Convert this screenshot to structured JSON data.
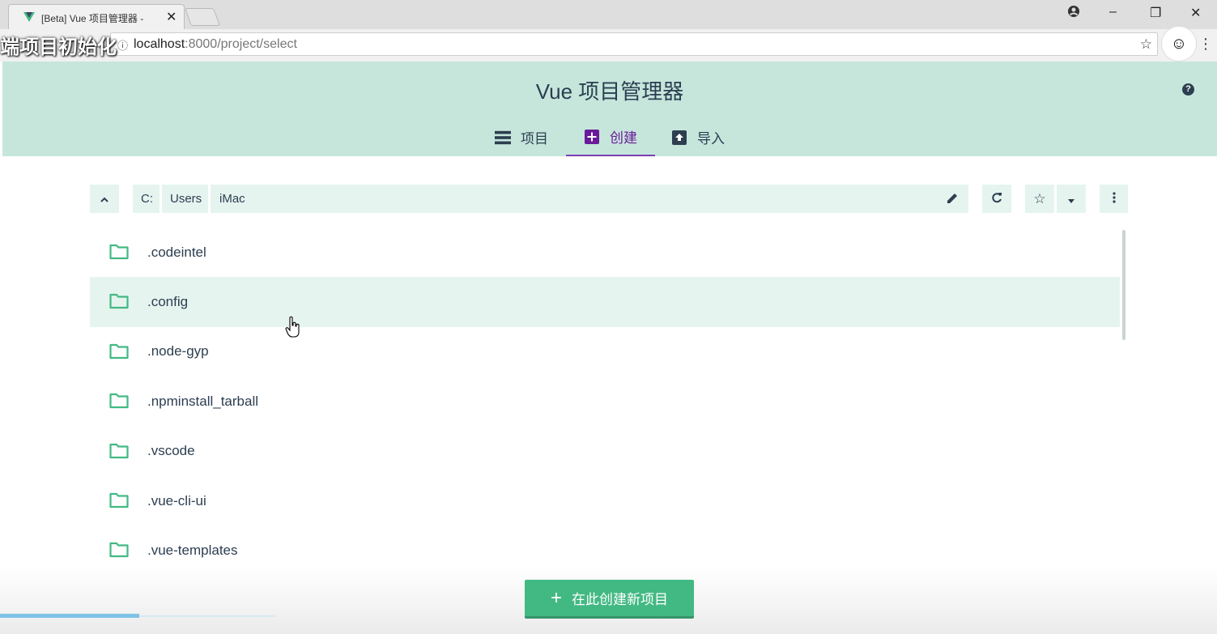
{
  "browser": {
    "tab_title": "[Beta] Vue 项目管理器 -",
    "tab_close": "✕",
    "url_host": "localhost",
    "url_rest": ":8000/project/select",
    "overlay_caption": "端项目初始化",
    "win_minimize": "–",
    "win_restore": "❐",
    "win_close": "✕"
  },
  "app": {
    "title": "Vue 项目管理器",
    "help": "?",
    "tabs": [
      {
        "label": "项目",
        "icon": "list-icon",
        "active": false
      },
      {
        "label": "创建",
        "icon": "add-box-icon",
        "active": true
      },
      {
        "label": "导入",
        "icon": "unarchive-icon",
        "active": false
      }
    ]
  },
  "pathbar": {
    "crumbs": [
      "C:",
      "Users",
      "iMac"
    ]
  },
  "folders": [
    ".codeintel",
    ".config",
    ".node-gyp",
    ".npminstall_tarball",
    ".vscode",
    ".vue-cli-ui",
    ".vue-templates"
  ],
  "hovered_folder_index": 1,
  "actions": {
    "create_label": "在此创建新项目",
    "create_plus": "+"
  },
  "colors": {
    "header_bg": "#c6e6dc",
    "accent_green": "#42b983",
    "active_tab": "#6a1b9a",
    "text": "#2c3e50"
  },
  "progress": 0.11
}
